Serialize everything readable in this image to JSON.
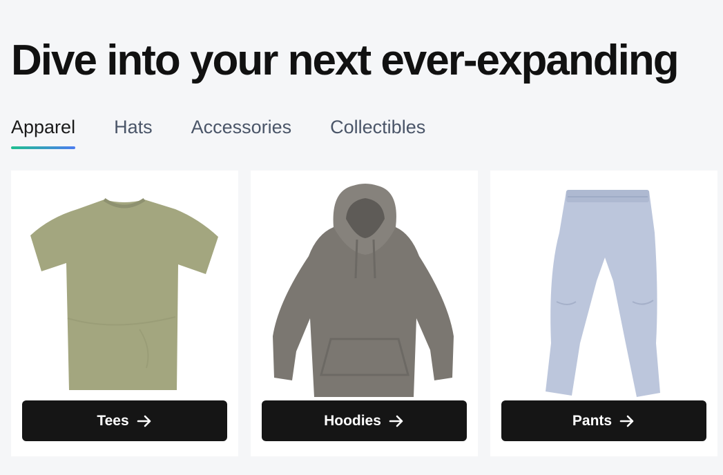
{
  "headline": "Dive into your next ever-expanding",
  "tabs": [
    {
      "label": "Apparel",
      "active": true
    },
    {
      "label": "Hats",
      "active": false
    },
    {
      "label": "Accessories",
      "active": false
    },
    {
      "label": "Collectibles",
      "active": false
    }
  ],
  "underline_gradient": [
    "#1fbf8f",
    "#4c7cf0"
  ],
  "cards": [
    {
      "label": "Tees",
      "image": "olive-tshirt",
      "color": "#a3a67f"
    },
    {
      "label": "Hoodies",
      "image": "gray-hoodie",
      "color": "#7b7771"
    },
    {
      "label": "Pants",
      "image": "light-blue-sweatpants",
      "color": "#bcc6dc"
    }
  ],
  "icons": {
    "cta_arrow": "arrow-right-icon"
  }
}
